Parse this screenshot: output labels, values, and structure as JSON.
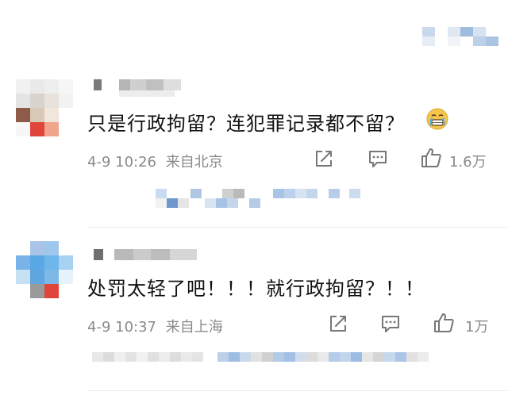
{
  "comments": [
    {
      "text": "只是行政拘留？连犯罪记录都不留？",
      "emoji_icon": "grimacing-tears-emoji-icon",
      "timestamp": "4-9 10:26",
      "location": "来自北京",
      "likes": "1.6万"
    },
    {
      "text": "处罚太轻了吧！！！就行政拘留？！！",
      "timestamp": "4-9 10:37",
      "location": "来自上海",
      "likes": "1万"
    }
  ],
  "icons": [
    "share-icon",
    "reply-icon",
    "like-icon"
  ],
  "colors": {
    "text": "#111111",
    "meta": "#8a8a8a",
    "pixel_blue": "#a8c4e6",
    "pixel_red": "#e0453a"
  }
}
